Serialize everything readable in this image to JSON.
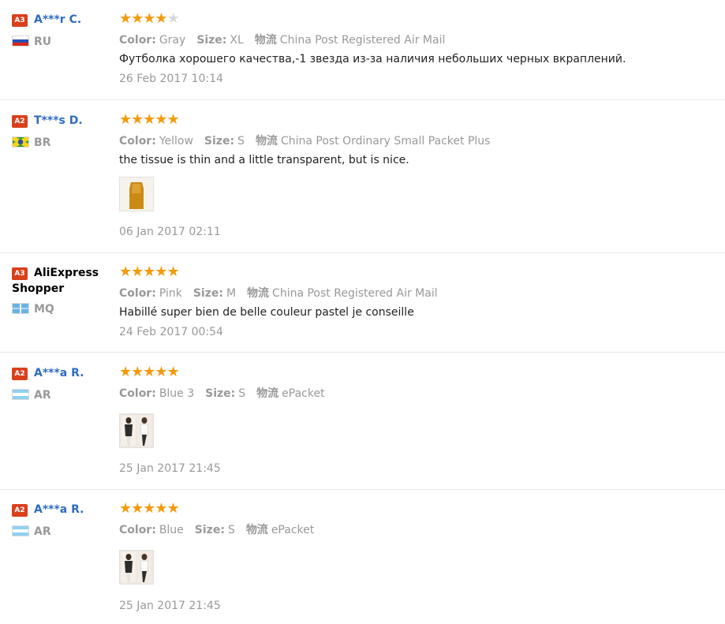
{
  "colors": {
    "link": "#2f6bc0",
    "badge": "#d9401c",
    "star_on": "#f39b0d",
    "star_off": "#d8d8d8",
    "muted": "#999999"
  },
  "labels": {
    "color": "Color:",
    "size": "Size:",
    "shipping": "物流"
  },
  "reviews": [
    {
      "badge": "A3",
      "name": "A***r C.",
      "country": "RU",
      "rating": 4,
      "color": "Gray",
      "size": "XL",
      "shipping": "China Post Registered Air Mail",
      "text": "Футболка хорошего качества,-1 звезда из-за наличия небольших черных вкраплений.",
      "date": "26 Feb 2017 10:14"
    },
    {
      "badge": "A2",
      "name": "T***s D.",
      "country": "BR",
      "rating": 5,
      "color": "Yellow",
      "size": "S",
      "shipping": "China Post Ordinary Small Packet Plus",
      "text": "the tissue is thin and a little transparent, but is nice.",
      "date": "06 Jan 2017 02:11"
    },
    {
      "badge": "A3",
      "name": "AliExpress Shopper",
      "country": "MQ",
      "rating": 5,
      "color": "Pink",
      "size": "M",
      "shipping": "China Post Registered Air Mail",
      "text": "Habillé super bien de belle couleur pastel je conseille",
      "date": "24 Feb 2017 00:54"
    },
    {
      "badge": "A2",
      "name": "A***a R.",
      "country": "AR",
      "rating": 5,
      "color": "Blue 3",
      "size": "S",
      "shipping": "ePacket",
      "text": "",
      "date": "25 Jan 2017 21:45"
    },
    {
      "badge": "A2",
      "name": "A***a R.",
      "country": "AR",
      "rating": 5,
      "color": "Blue",
      "size": "S",
      "shipping": "ePacket",
      "text": "",
      "date": "25 Jan 2017 21:45"
    }
  ]
}
